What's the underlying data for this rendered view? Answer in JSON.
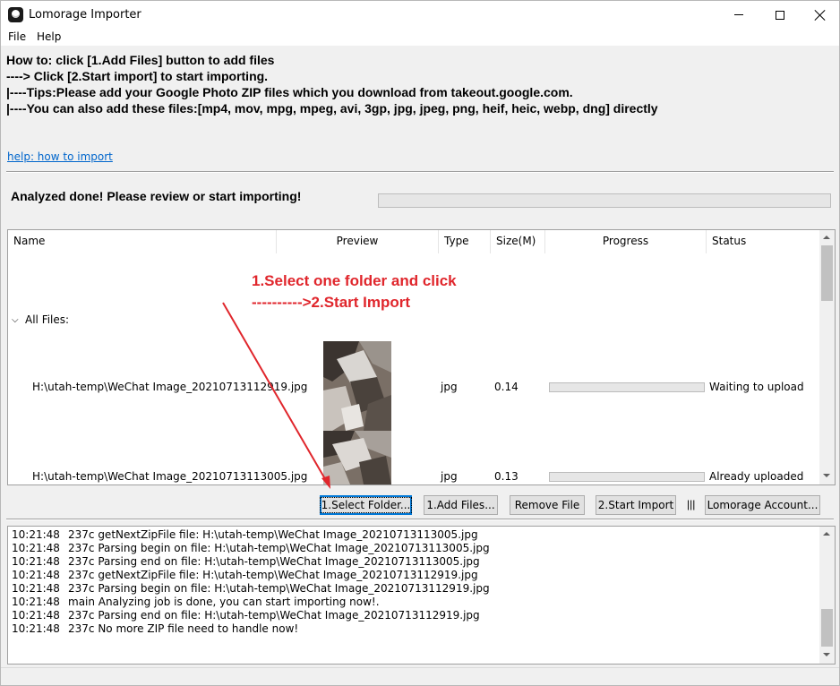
{
  "window": {
    "title": "Lomorage Importer"
  },
  "menu": {
    "items": [
      "File",
      "Help"
    ]
  },
  "instructions": {
    "lines": [
      "How to: click [1.Add Files] button to add files",
      "----> Click [2.Start import] to start importing.",
      "|----Tips:Please add your Google Photo ZIP files which you download from takeout.google.com.",
      "|----You can also add these files:[mp4, mov, mpg, mpeg, avi, 3gp, jpg, jpeg, png, heif, heic, webp, dng] directly"
    ],
    "help_link": "help: how to import"
  },
  "analysis": {
    "status_text": "Analyzed done! Please review or start importing!",
    "progress": 0
  },
  "table": {
    "columns": [
      "Name",
      "Preview",
      "Type",
      "Size(M)",
      "Progress",
      "Status"
    ],
    "group_label": "All Files:",
    "rows": [
      {
        "name": "H:\\utah-temp\\WeChat Image_20210713112919.jpg",
        "type": "jpg",
        "size": "0.14",
        "progress": 0,
        "status": "Waiting to upload"
      },
      {
        "name": "H:\\utah-temp\\WeChat Image_20210713113005.jpg",
        "type": "jpg",
        "size": "0.13",
        "progress": 0,
        "status": "Already uploaded"
      }
    ]
  },
  "annotation": {
    "line1": "1.Select one folder and click",
    "line2": "---------->2.Start Import",
    "color": "#e0262c"
  },
  "buttons": {
    "select_folder": "1.Select Folder...",
    "add_files": "1.Add Files...",
    "remove_file": "Remove File",
    "start_import": "2.Start Import",
    "separator": "|||",
    "account": "Lomorage Account..."
  },
  "log": [
    {
      "time": "10:21:48",
      "msg": "237c getNextZipFile file: H:\\utah-temp\\WeChat Image_20210713113005.jpg"
    },
    {
      "time": "10:21:48",
      "msg": "237c Parsing begin on file: H:\\utah-temp\\WeChat Image_20210713113005.jpg"
    },
    {
      "time": "10:21:48",
      "msg": "237c Parsing end on file: H:\\utah-temp\\WeChat Image_20210713113005.jpg"
    },
    {
      "time": "10:21:48",
      "msg": "237c getNextZipFile file: H:\\utah-temp\\WeChat Image_20210713112919.jpg"
    },
    {
      "time": "10:21:48",
      "msg": "237c Parsing begin on file: H:\\utah-temp\\WeChat Image_20210713112919.jpg"
    },
    {
      "time": "10:21:48",
      "msg": "main Analyzing job is done, you can start importing now!."
    },
    {
      "time": "10:21:48",
      "msg": "237c Parsing end on file: H:\\utah-temp\\WeChat Image_20210713112919.jpg"
    },
    {
      "time": "10:21:48",
      "msg": "237c No more ZIP file need to handle now!"
    }
  ]
}
